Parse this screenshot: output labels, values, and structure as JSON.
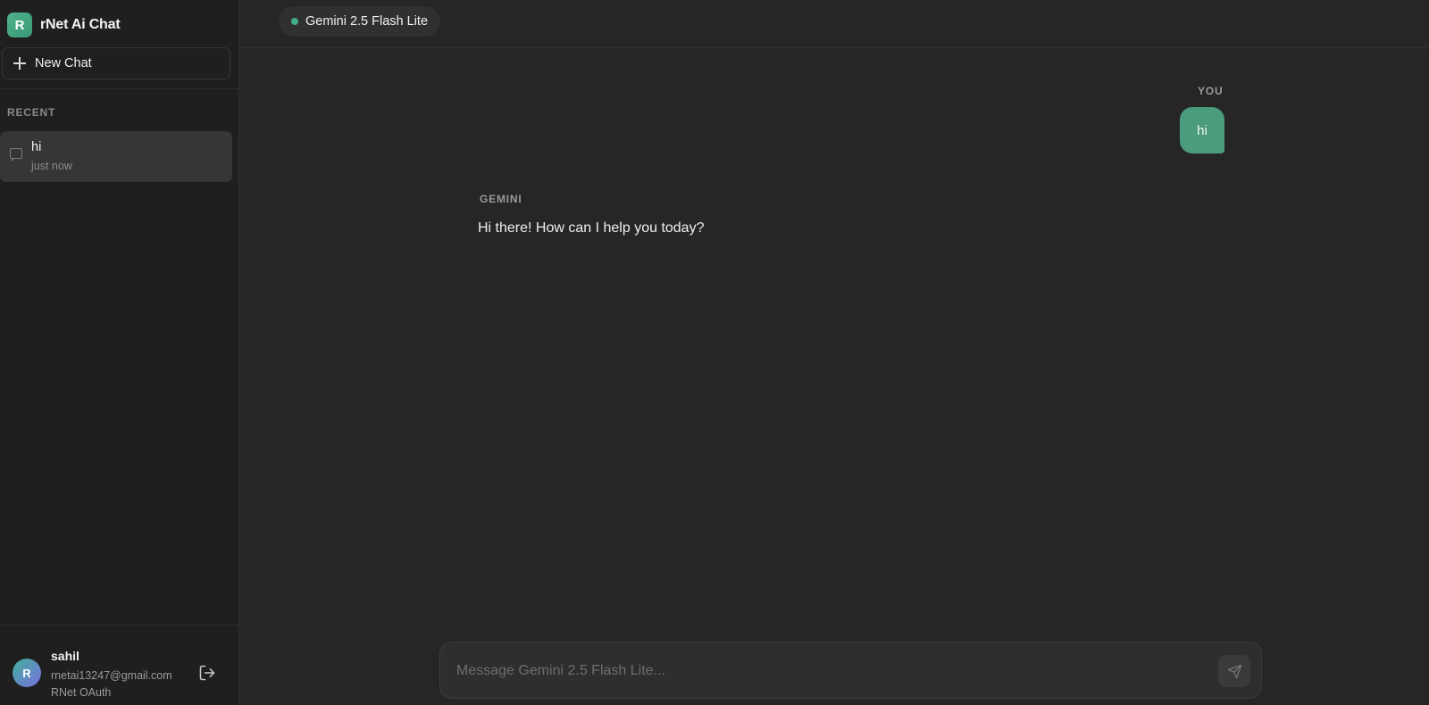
{
  "app": {
    "logo_letter": "R",
    "title": "rNet Ai Chat"
  },
  "sidebar": {
    "new_chat_label": "New Chat",
    "recent_label": "RECENT",
    "recent_chats": [
      {
        "title": "hi",
        "time": "just now"
      }
    ]
  },
  "user": {
    "avatar_letter": "R",
    "name": "sahil",
    "email": "rnetai13247@gmail.com",
    "provider": "RNet OAuth"
  },
  "header": {
    "model_name": "Gemini 2.5 Flash Lite",
    "status_color": "#3fae85"
  },
  "conversation": {
    "user_label": "YOU",
    "user_message": "hi",
    "assistant_label": "GEMINI",
    "assistant_message": "Hi there! How can I help you today?"
  },
  "composer": {
    "placeholder": "Message Gemini 2.5 Flash Lite...",
    "value": ""
  },
  "icons": {
    "new_chat": "plus-icon",
    "chat_item": "message-square-icon",
    "logout": "log-out-icon",
    "send": "send-icon"
  },
  "colors": {
    "accent": "#4a9c7c",
    "background": "#262626",
    "sidebar": "#1f1f1f"
  }
}
